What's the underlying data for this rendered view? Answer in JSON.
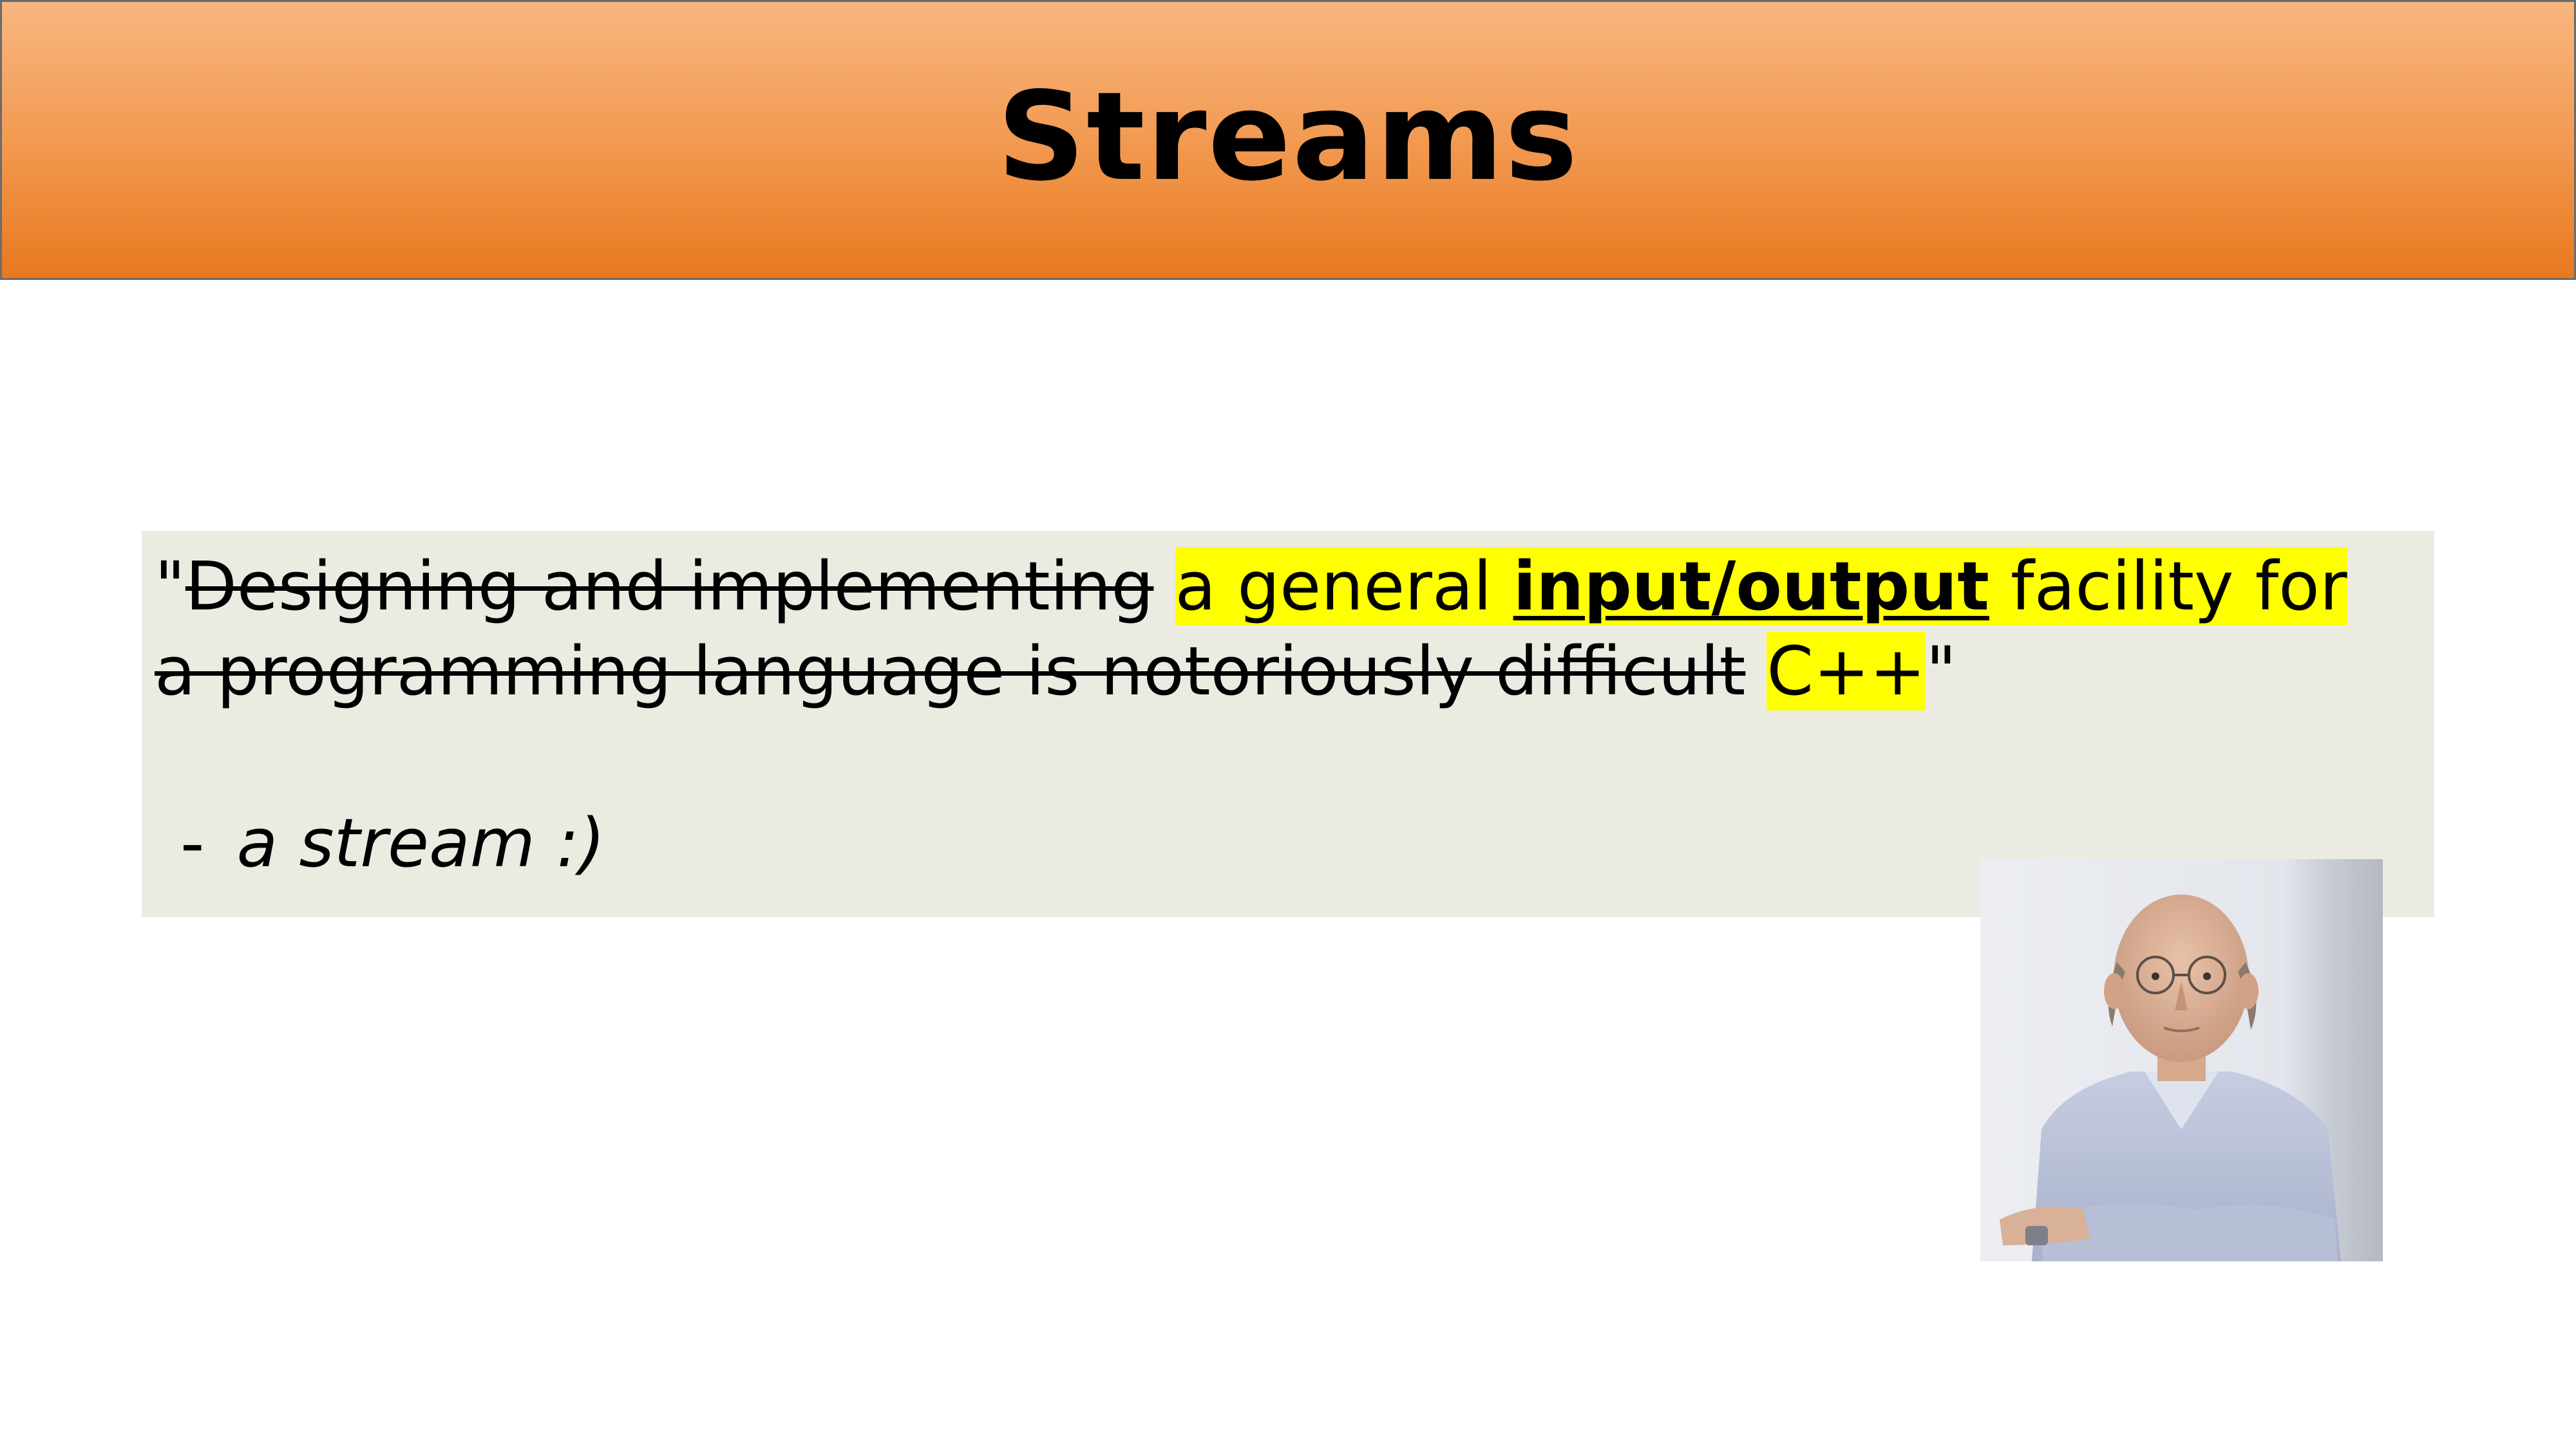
{
  "slide": {
    "title": "Streams",
    "quote": {
      "open_quote": "\"",
      "struck_1": "Designing and implementing",
      "hl_1": "a general ",
      "hl_strong": "input/output",
      "hl_2": " facility for",
      "struck_2": "a programming language is notoriously difficult",
      "hl_3": "C++",
      "close_quote": "\""
    },
    "attribution": {
      "dash": "-",
      "text": "a stream :)"
    },
    "portrait_icon": "portrait-photo",
    "colors": {
      "title_bar_top": "#f8b680",
      "title_bar_bottom": "#e8781e",
      "quote_background": "#ecebe2",
      "highlight": "#ffff00"
    }
  }
}
